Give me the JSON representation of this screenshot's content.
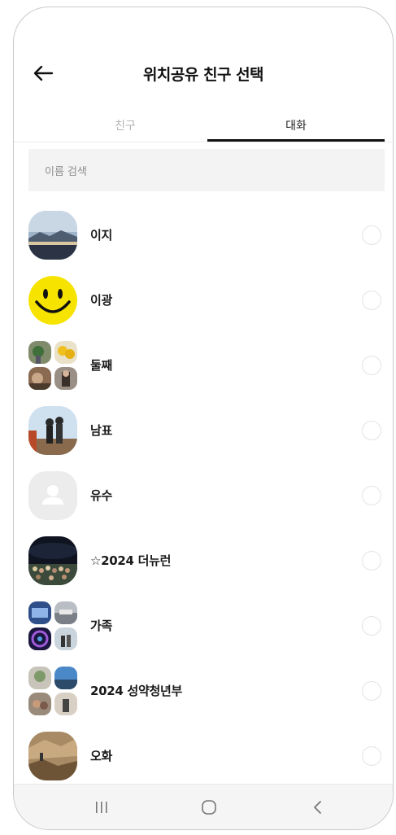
{
  "header": {
    "title": "위치공유 친구 선택",
    "back_icon": "arrow-left-icon"
  },
  "tabs": [
    {
      "label": "친구",
      "selected": false
    },
    {
      "label": "대화",
      "selected": true
    }
  ],
  "search": {
    "placeholder": "이름 검색"
  },
  "chats": [
    {
      "name": "이지",
      "avatar": "landscape-photo",
      "selected": false
    },
    {
      "name": "이광",
      "avatar": "smiley-face",
      "selected": false
    },
    {
      "name": "둘째",
      "avatar": "group-photo-grid",
      "selected": false
    },
    {
      "name": "남표",
      "avatar": "couple-photo",
      "selected": false
    },
    {
      "name": "유수",
      "avatar": "default-person-icon",
      "selected": false
    },
    {
      "name": "☆2024 더뉴런",
      "avatar": "night-event-photo",
      "selected": false
    },
    {
      "name": "가족",
      "avatar": "group-photo-grid",
      "selected": false
    },
    {
      "name": "2024 성약청년부",
      "avatar": "group-photo-grid",
      "selected": false
    },
    {
      "name": "오화",
      "avatar": "rocky-landscape-photo",
      "selected": false
    }
  ],
  "navbar": {
    "recent_icon": "recent-apps-icon",
    "home_icon": "home-icon",
    "back_icon": "back-chevron-icon"
  },
  "colors": {
    "accent": "#111111",
    "inactive_tab": "#b5b5b5",
    "search_bg": "#f3f3f4"
  }
}
